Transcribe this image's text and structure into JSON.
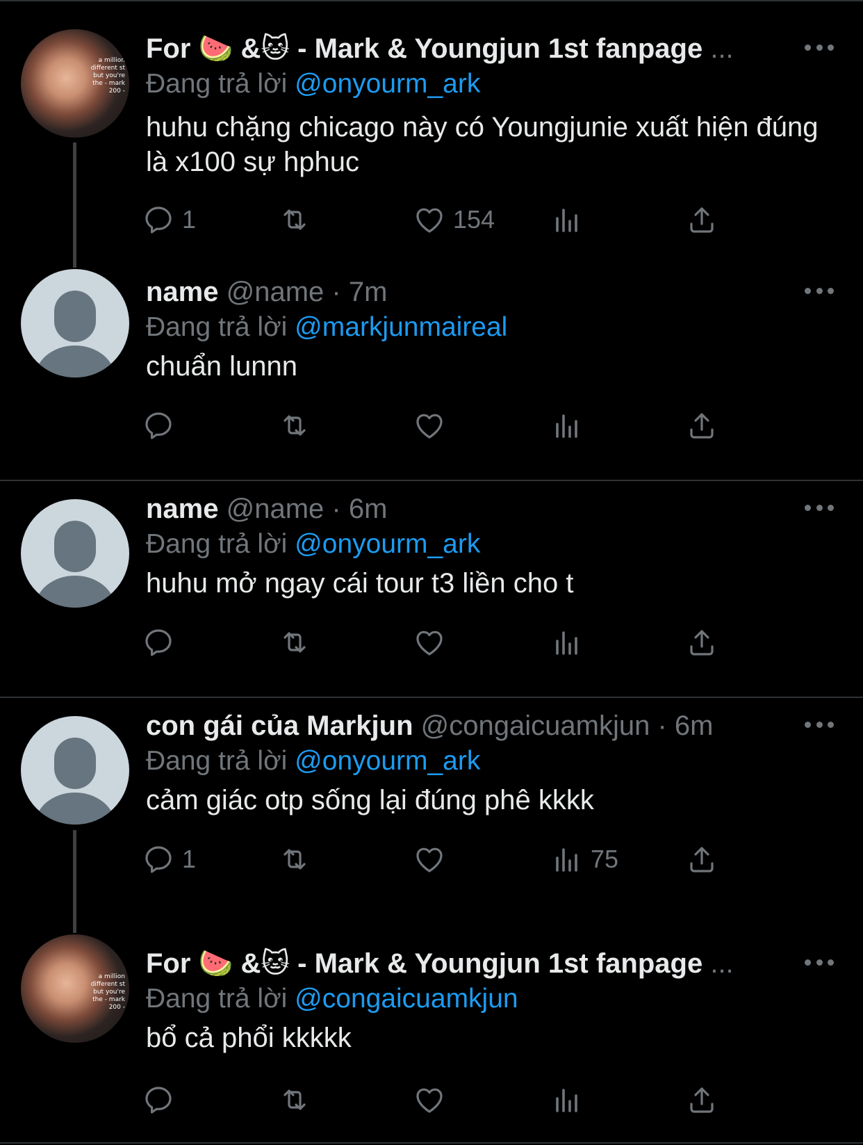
{
  "tweets": [
    {
      "name": "For 🍉 &🐱 - Mark & Youngjun 1st fanpage",
      "ellipsis": "...",
      "handle": "",
      "time": "",
      "replying_prefix": "Đang trả lời",
      "replying_to": "@onyourm_ark",
      "text": "huhu chặng chicago này có Youngjunie xuất hiện đúng là x100 sự hphuc",
      "reply_count": "1",
      "retweet_count": "",
      "like_count": "154",
      "view_count": "",
      "avatar": "photo",
      "avatar_text": "a million different st but you're the - mark 200 -"
    },
    {
      "name": "name",
      "handle": "@name",
      "dot": "·",
      "time": "7m",
      "replying_prefix": "Đang trả lời",
      "replying_to": "@markjunmaireal",
      "text": "chuẩn lunnn",
      "reply_count": "",
      "retweet_count": "",
      "like_count": "",
      "view_count": "",
      "avatar": "default"
    },
    {
      "name": "name",
      "handle": "@name",
      "dot": "·",
      "time": "6m",
      "replying_prefix": "Đang trả lời",
      "replying_to": "@onyourm_ark",
      "text": "huhu mở ngay cái tour t3 liền cho t",
      "reply_count": "",
      "retweet_count": "",
      "like_count": "",
      "view_count": "",
      "avatar": "default"
    },
    {
      "name": "con gái của Markjun",
      "handle": "@congaicuamkjun",
      "dot": "·",
      "time": "6m",
      "replying_prefix": "Đang trả lời",
      "replying_to": "@onyourm_ark",
      "text": "cảm giác otp sống lại đúng phê kkkk",
      "reply_count": "1",
      "retweet_count": "",
      "like_count": "",
      "view_count": "75",
      "avatar": "default"
    },
    {
      "name": "For 🍉 &🐱 - Mark & Youngjun 1st fanpage",
      "ellipsis": "...",
      "handle": "",
      "time": "",
      "replying_prefix": "Đang trả lời",
      "replying_to": "@congaicuamkjun",
      "text": "bổ cả phổi kkkkk",
      "reply_count": "",
      "retweet_count": "",
      "like_count": "",
      "view_count": "",
      "avatar": "photo",
      "avatar_text": "a million different st but you're the - mark 200 -"
    }
  ],
  "icons": [
    "reply-icon",
    "retweet-icon",
    "like-icon",
    "views-icon",
    "share-icon",
    "more-options-icon"
  ],
  "colors": {
    "background": "#000000",
    "text": "#e7e9ea",
    "secondary": "#71767b",
    "mention": "#1d9bf0",
    "divider": "#2f3336",
    "default_avatar": "#ccd6dd"
  }
}
